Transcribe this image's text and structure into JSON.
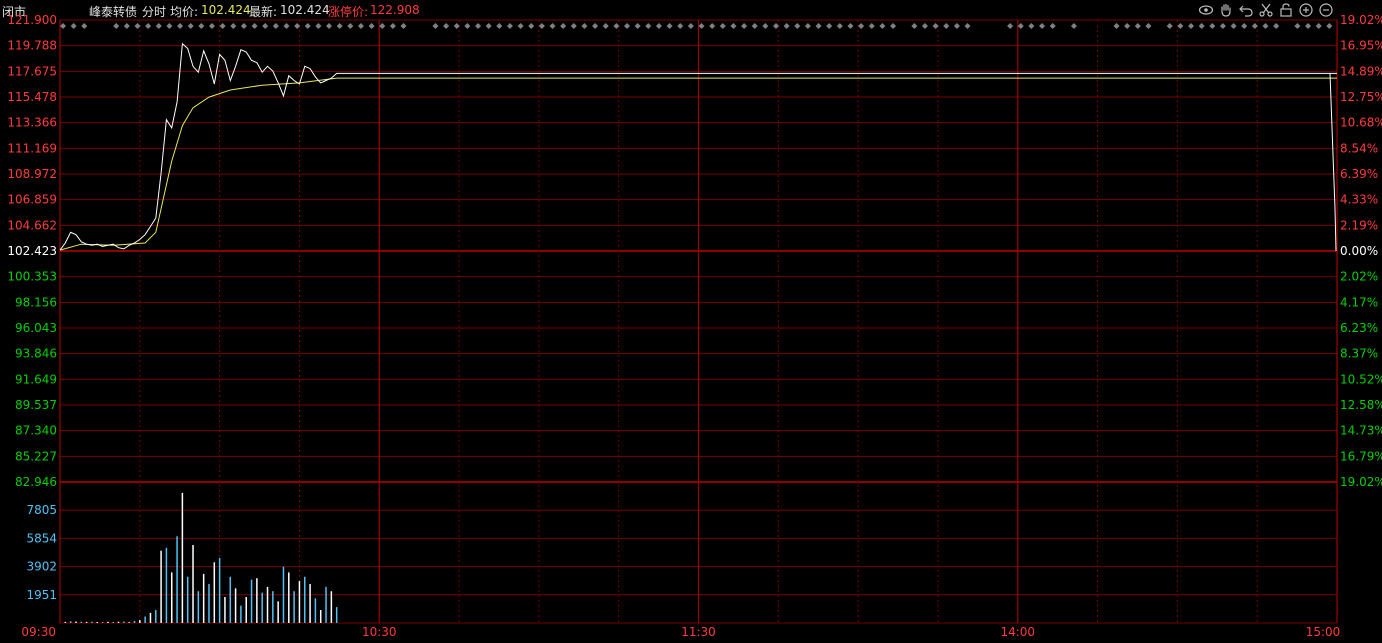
{
  "header": {
    "status": "闭市",
    "name": "峰泰转债",
    "mode": "分时",
    "avg_label": "均价:",
    "avg_value": "102.424",
    "last_label": "最新:",
    "last_value": "102.424",
    "limit_label": "涨停价:",
    "limit_value": "122.908"
  },
  "toolbar": {
    "icons": [
      "eye-icon",
      "hand-icon",
      "undo-icon",
      "scissors-icon",
      "lock-icon",
      "zoom-in-icon",
      "zoom-out-icon"
    ]
  },
  "colors": {
    "grid": "#7a0000",
    "red": "#ff3b3b",
    "green": "#00d000",
    "cyan": "#4fc3f7",
    "yellow": "#e8e85a",
    "white": "#ffffff",
    "diamond": "#808080"
  },
  "chart_data": {
    "type": "line",
    "price_axis": {
      "ticks": [
        "121.900",
        "119.788",
        "117.675",
        "115.478",
        "113.366",
        "111.169",
        "108.972",
        "106.859",
        "104.662",
        "102.423",
        "100.353",
        "98.156",
        "96.043",
        "93.846",
        "91.649",
        "89.537",
        "87.340",
        "85.227",
        "82.946"
      ],
      "range": [
        82.946,
        121.9
      ],
      "base": 102.423
    },
    "pct_axis": {
      "ticks": [
        "19.02%",
        "16.95%",
        "14.89%",
        "12.75%",
        "10.68%",
        "8.54%",
        "6.39%",
        "4.33%",
        "2.19%",
        "0.00%",
        "2.02%",
        "4.17%",
        "6.23%",
        "8.37%",
        "10.52%",
        "12.58%",
        "14.73%",
        "16.79%",
        "19.02%"
      ]
    },
    "volume_axis": {
      "ticks": [
        "7805",
        "5854",
        "3902",
        "1951"
      ],
      "range": [
        0,
        9756
      ]
    },
    "time_axis": {
      "labels": [
        "09:30",
        "10:30",
        "11:30",
        "14:00",
        "15:00"
      ],
      "total_minutes": 240
    },
    "price_series": [
      [
        0,
        102.5
      ],
      [
        1,
        103.1
      ],
      [
        2,
        104.0
      ],
      [
        3,
        103.8
      ],
      [
        4,
        103.2
      ],
      [
        5,
        103.0
      ],
      [
        6,
        102.9
      ],
      [
        7,
        103.0
      ],
      [
        8,
        102.8
      ],
      [
        9,
        102.9
      ],
      [
        10,
        103.0
      ],
      [
        11,
        102.7
      ],
      [
        12,
        102.6
      ],
      [
        13,
        102.9
      ],
      [
        14,
        103.1
      ],
      [
        15,
        103.4
      ],
      [
        16,
        103.8
      ],
      [
        17,
        104.5
      ],
      [
        18,
        105.2
      ],
      [
        19,
        109.0
      ],
      [
        20,
        113.5
      ],
      [
        21,
        112.8
      ],
      [
        22,
        115.0
      ],
      [
        23,
        119.9
      ],
      [
        24,
        119.5
      ],
      [
        25,
        118.0
      ],
      [
        26,
        117.5
      ],
      [
        27,
        119.3
      ],
      [
        28,
        118.2
      ],
      [
        29,
        116.5
      ],
      [
        30,
        119.0
      ],
      [
        31,
        118.5
      ],
      [
        32,
        116.8
      ],
      [
        33,
        118.0
      ],
      [
        34,
        119.4
      ],
      [
        35,
        119.2
      ],
      [
        36,
        118.5
      ],
      [
        37,
        118.3
      ],
      [
        38,
        117.5
      ],
      [
        39,
        118.0
      ],
      [
        40,
        117.6
      ],
      [
        41,
        116.6
      ],
      [
        42,
        115.5
      ],
      [
        43,
        117.2
      ],
      [
        44,
        116.8
      ],
      [
        45,
        116.5
      ],
      [
        46,
        118.0
      ],
      [
        47,
        117.8
      ],
      [
        48,
        117.1
      ],
      [
        49,
        116.6
      ],
      [
        50,
        116.8
      ],
      [
        51,
        117.0
      ],
      [
        52,
        117.4
      ],
      [
        240,
        117.4
      ]
    ],
    "avg_series": [
      [
        0,
        102.5
      ],
      [
        4,
        103.0
      ],
      [
        10,
        102.9
      ],
      [
        16,
        103.1
      ],
      [
        18,
        104.0
      ],
      [
        19,
        106.0
      ],
      [
        21,
        110.0
      ],
      [
        23,
        113.0
      ],
      [
        25,
        114.5
      ],
      [
        28,
        115.4
      ],
      [
        32,
        116.0
      ],
      [
        38,
        116.4
      ],
      [
        45,
        116.6
      ],
      [
        52,
        117.0
      ],
      [
        240,
        117.0
      ]
    ],
    "volume_bars": [
      [
        1,
        80
      ],
      [
        2,
        120
      ],
      [
        3,
        100
      ],
      [
        4,
        90
      ],
      [
        5,
        80
      ],
      [
        6,
        90
      ],
      [
        7,
        70
      ],
      [
        8,
        60
      ],
      [
        9,
        80
      ],
      [
        10,
        70
      ],
      [
        11,
        90
      ],
      [
        12,
        100
      ],
      [
        13,
        60
      ],
      [
        14,
        150
      ],
      [
        15,
        200
      ],
      [
        16,
        450
      ],
      [
        17,
        700
      ],
      [
        18,
        900
      ],
      [
        19,
        5000
      ],
      [
        20,
        5200
      ],
      [
        21,
        3500
      ],
      [
        22,
        6000
      ],
      [
        23,
        9000
      ],
      [
        24,
        3200
      ],
      [
        25,
        5400
      ],
      [
        26,
        2200
      ],
      [
        27,
        3400
      ],
      [
        28,
        2700
      ],
      [
        29,
        4200
      ],
      [
        30,
        4500
      ],
      [
        31,
        1800
      ],
      [
        32,
        3200
      ],
      [
        33,
        2400
      ],
      [
        34,
        1200
      ],
      [
        35,
        1800
      ],
      [
        36,
        3000
      ],
      [
        37,
        3100
      ],
      [
        38,
        2100
      ],
      [
        39,
        2500
      ],
      [
        40,
        2200
      ],
      [
        41,
        1500
      ],
      [
        42,
        3900
      ],
      [
        43,
        3500
      ],
      [
        44,
        2200
      ],
      [
        45,
        2900
      ],
      [
        46,
        3200
      ],
      [
        47,
        2700
      ],
      [
        48,
        1700
      ],
      [
        49,
        900
      ],
      [
        50,
        2500
      ],
      [
        51,
        2200
      ],
      [
        52,
        1100
      ]
    ],
    "diamond_markers_minutes": [
      0,
      2,
      4,
      10,
      12,
      14,
      16,
      18,
      20,
      22,
      24,
      26,
      28,
      30,
      32,
      34,
      36,
      38,
      40,
      42,
      44,
      46,
      48,
      50,
      52,
      54,
      56,
      58,
      60,
      62,
      64,
      70,
      72,
      74,
      76,
      78,
      80,
      82,
      84,
      86,
      88,
      90,
      92,
      94,
      96,
      98,
      100,
      102,
      104,
      106,
      108,
      110,
      112,
      114,
      116,
      118,
      120,
      122,
      124,
      126,
      128,
      130,
      132,
      134,
      136,
      138,
      140,
      142,
      144,
      146,
      148,
      150,
      152,
      154,
      156,
      160,
      162,
      164,
      166,
      168,
      170,
      178,
      180,
      182,
      184,
      186,
      190,
      198,
      200,
      202,
      204,
      208,
      210,
      212,
      214,
      216,
      218,
      220,
      222,
      224,
      226,
      228,
      232,
      234,
      236,
      238
    ]
  }
}
